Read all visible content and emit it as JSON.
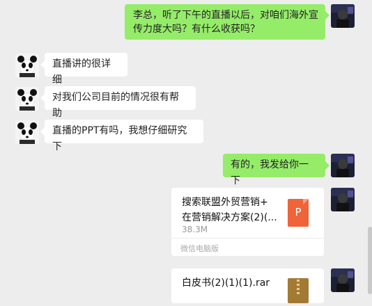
{
  "messages": [
    {
      "from": "me",
      "text_line1": "李总，听了下午的直播以后，对咱们海外宣",
      "text_line2": "传力度大吗？有什么收获吗？"
    },
    {
      "from": "other",
      "text": "直播讲的很详细"
    },
    {
      "from": "other",
      "text": "对我们公司目前的情况很有帮助"
    },
    {
      "from": "other",
      "text": "直播的PPT有吗，我想仔细研究下"
    },
    {
      "from": "me",
      "text": "有的，我发给你一下"
    }
  ],
  "file1": {
    "title_line1": "搜索联盟外贸营销+",
    "title_line2": "在营销解决方案(2)(...",
    "size": "38.3M",
    "source": "微信电脑版",
    "icon": "ppt-file-icon",
    "icon_letter": "P"
  },
  "file2": {
    "title": "白皮书(2)(1)(1).rar",
    "icon": "rar-file-icon"
  },
  "colors": {
    "me_bubble": "#95ec69",
    "other_bubble": "#ffffff",
    "background": "#ededed",
    "ppt": "#f0643a",
    "rar": "#a37a34"
  }
}
